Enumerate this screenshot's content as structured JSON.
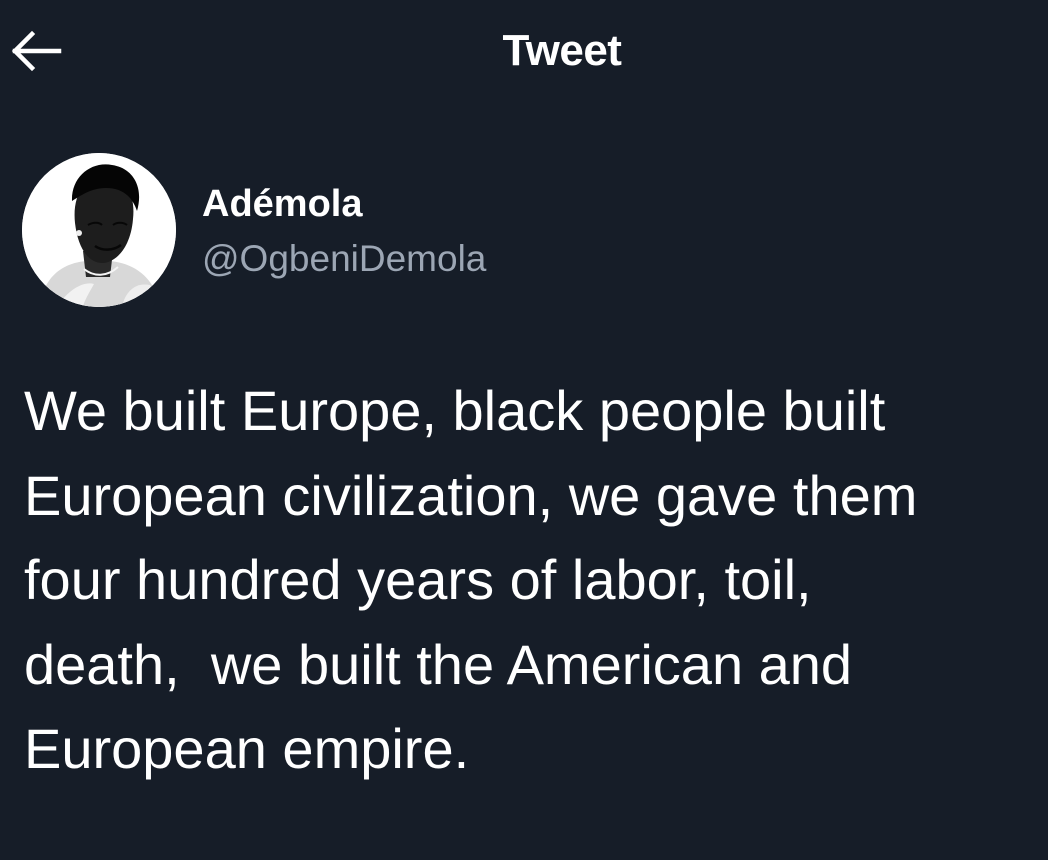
{
  "top_bar": {
    "back_icon": "arrow-left-icon",
    "title": "Tweet"
  },
  "author": {
    "display_name": "Adémola",
    "handle": "@OgbeniDemola",
    "avatar": "profile-photo-avatar"
  },
  "tweet": {
    "lines": [
      "We built Europe, black people built",
      "European civilization, we gave them",
      "four hundred years of labor, toil,",
      "death,  we built the American and",
      "European empire."
    ]
  },
  "colors": {
    "background": "#161d28",
    "primary_text": "#ffffff",
    "secondary_text": "#9ca6b4"
  }
}
